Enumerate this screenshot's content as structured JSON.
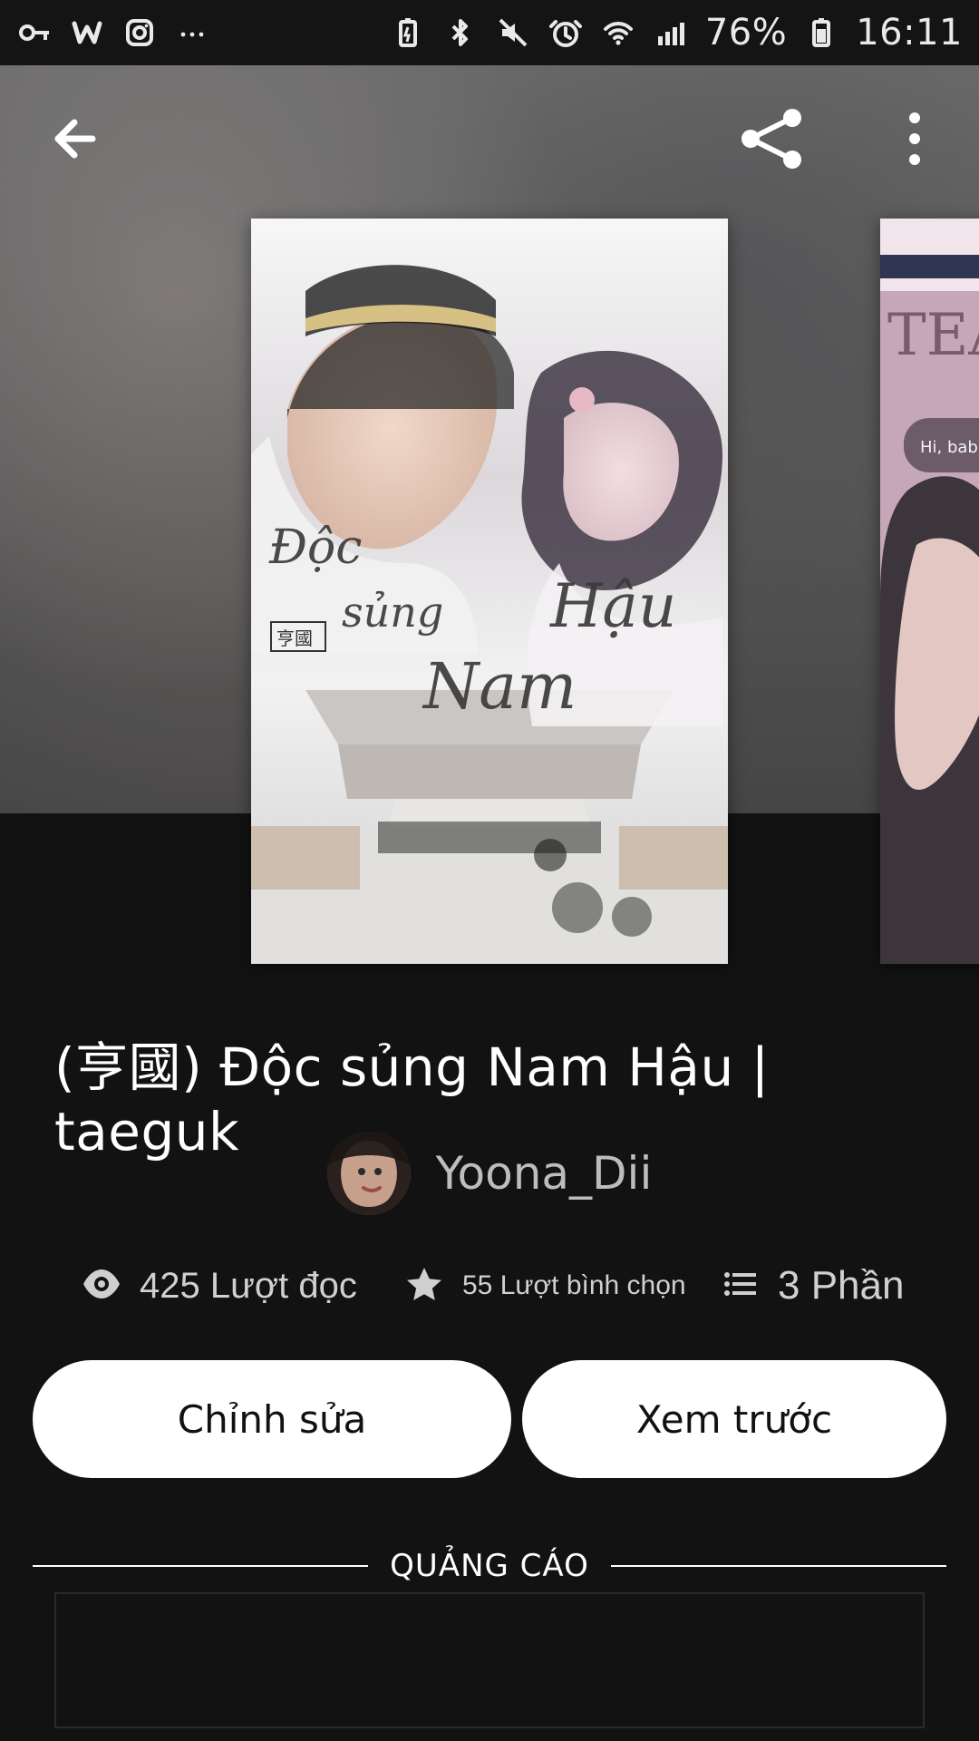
{
  "status_bar": {
    "battery_percent": "76%",
    "time": "16:11",
    "left_icons": [
      "key-icon",
      "wattpad-icon",
      "instagram-icon",
      "more-notifications-icon"
    ],
    "right_icons": [
      "battery-saver-icon",
      "bluetooth-icon",
      "mute-icon",
      "alarm-icon",
      "wifi-icon",
      "signal-icon",
      "battery-icon"
    ]
  },
  "toolbar": {
    "back_icon": "arrow-left-icon",
    "share_icon": "share-icon",
    "more_icon": "more-vertical-icon"
  },
  "story": {
    "title": "(亨國) Độc sủng Nam Hậu | taeguk",
    "cover_text": [
      "Độc",
      "sủng",
      "Nam",
      "Hậu",
      "亨國"
    ],
    "next_cover_text": [
      "TEA",
      "Hi, bab"
    ]
  },
  "author": {
    "name": "Yoona_Dii"
  },
  "stats": {
    "reads": "425 Lượt đọc",
    "votes": "55 Lượt bình chọn",
    "parts": "3 Phần"
  },
  "actions": {
    "edit": "Chỉnh sửa",
    "preview": "Xem trước"
  },
  "ads": {
    "label": "QUẢNG CÁO"
  }
}
